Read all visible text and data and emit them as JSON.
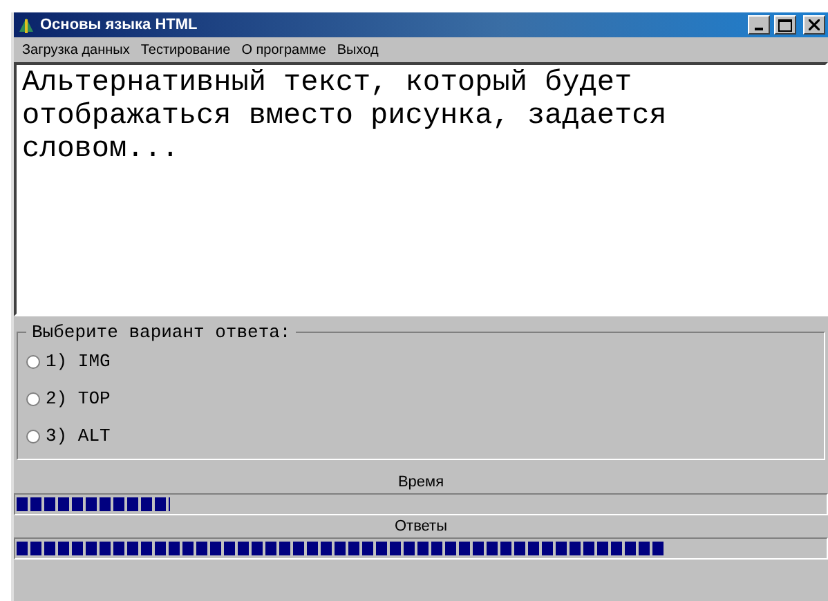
{
  "window": {
    "title": "Основы языка HTML"
  },
  "menu": [
    "Загрузка данных",
    "Тестирование",
    "О программе",
    "Выход"
  ],
  "question": "Альтернативный текст, который будет отображаться вместо рисунка, задается словом...",
  "answers": {
    "legend": "Выберите вариант ответа:",
    "options": [
      {
        "label": "1) IMG",
        "selected": false
      },
      {
        "label": "2) TOP",
        "selected": false
      },
      {
        "label": "3) ALT",
        "selected": false
      }
    ]
  },
  "progress": [
    {
      "label": "Время",
      "level": 0.19
    },
    {
      "label": "Ответы",
      "level": 0.8
    }
  ]
}
